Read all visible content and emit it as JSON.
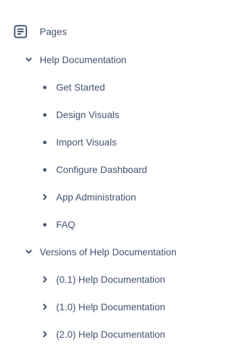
{
  "tree": {
    "root": {
      "label": "Pages",
      "icon": "page-icon"
    },
    "sections": [
      {
        "label": "Help Documentation",
        "expanded": true,
        "children": [
          {
            "label": "Get Started",
            "type": "leaf"
          },
          {
            "label": "Design Visuals",
            "type": "leaf"
          },
          {
            "label": "Import Visuals",
            "type": "leaf"
          },
          {
            "label": "Configure Dashboard",
            "type": "leaf"
          },
          {
            "label": "App Administration",
            "type": "collapsed"
          },
          {
            "label": "FAQ",
            "type": "leaf"
          }
        ]
      },
      {
        "label": "Versions of Help Documentation",
        "expanded": true,
        "children": [
          {
            "label": "(0.1) Help Documentation",
            "type": "collapsed"
          },
          {
            "label": "(1.0) Help Documentation",
            "type": "collapsed"
          },
          {
            "label": "(2.0) Help Documentation",
            "type": "collapsed"
          }
        ]
      }
    ]
  },
  "colors": {
    "text": "#42526e",
    "background": "#ffffff"
  }
}
